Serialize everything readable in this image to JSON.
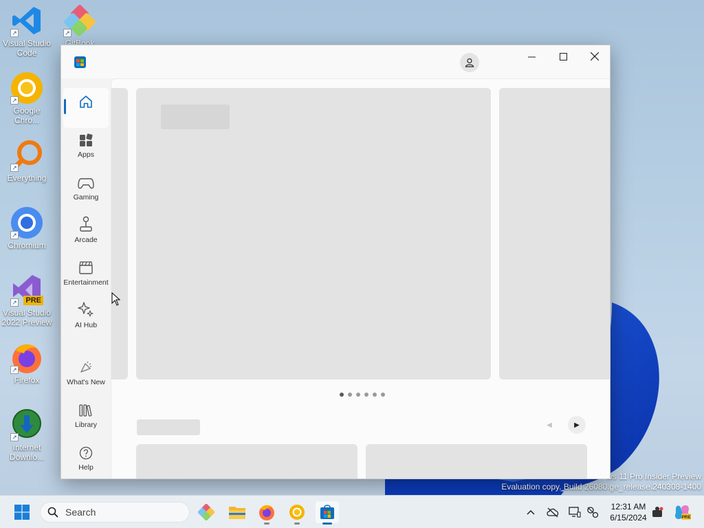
{
  "desktop": {
    "icons": [
      {
        "label": "Visual Studio Code",
        "icon": "vscode-icon"
      },
      {
        "label": "GitBook",
        "icon": "gitbook-icon"
      },
      {
        "label": "Google Chro...",
        "icon": "chrome-icon"
      },
      {
        "label": "Everything",
        "icon": "everything-search-icon"
      },
      {
        "label": "Chromium",
        "icon": "chromium-icon"
      },
      {
        "label": "Visual Studio 2022 Preview",
        "icon": "visual-studio-preview-icon",
        "badge": "PRE"
      },
      {
        "label": "Firefox",
        "icon": "firefox-icon"
      },
      {
        "label": "Internet Downlo...",
        "icon": "internet-download-manager-icon"
      }
    ],
    "watermark": {
      "line1": "ws 11 Pro Insider Preview",
      "line2": "Evaluation copy. Build 26080.ge_release.240308-1400"
    }
  },
  "window": {
    "app": "Microsoft Store",
    "app_icon": "store-logo-icon",
    "controls": {
      "minimize": "minimize-icon",
      "maximize": "maximize-icon",
      "close": "close-icon"
    },
    "account_icon": "account-icon",
    "sidebar": {
      "items": [
        {
          "label": "",
          "icon": "home-icon",
          "active": true
        },
        {
          "label": "Apps",
          "icon": "apps-icon"
        },
        {
          "label": "Gaming",
          "icon": "gamepad-icon"
        },
        {
          "label": "Arcade",
          "icon": "joystick-icon"
        },
        {
          "label": "Entertainment",
          "icon": "clapperboard-icon"
        },
        {
          "label": "AI Hub",
          "icon": "sparkle-icon"
        },
        {
          "label": "What's New",
          "icon": "megaphone-icon"
        },
        {
          "label": "Library",
          "icon": "library-icon"
        },
        {
          "label": "Help",
          "icon": "help-icon"
        }
      ]
    },
    "content": {
      "state": "loading",
      "carousel_pages": 6,
      "carousel_current": 1
    }
  },
  "taskbar": {
    "search_placeholder": "Search",
    "apps": [
      {
        "name": "start-button",
        "icon": "windows-logo-icon"
      },
      {
        "name": "gitbook",
        "icon": "gitbook-icon"
      },
      {
        "name": "file-explorer",
        "icon": "folder-icon"
      },
      {
        "name": "firefox",
        "icon": "firefox-icon"
      },
      {
        "name": "chrome",
        "icon": "chrome-icon"
      },
      {
        "name": "microsoft-store",
        "icon": "store-icon",
        "active": true
      }
    ],
    "tray": [
      "chevron-up-icon",
      "cloud-off-icon",
      "display-icon",
      "network-icon",
      "game-bar-icon",
      "copilot-icon"
    ],
    "time": "12:31 AM",
    "date": "6/15/2024"
  },
  "colors": {
    "accent": "#0f6cbd",
    "window_bg": "#f3f3f3",
    "placeholder": "#e3e3e3"
  }
}
